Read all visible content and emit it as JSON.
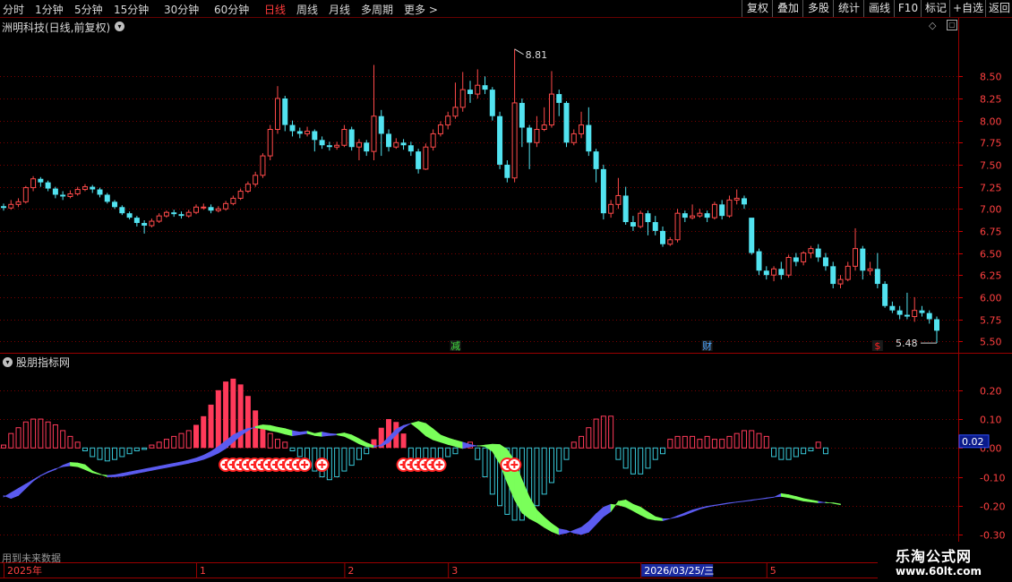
{
  "toolbar": {
    "periods": [
      "分时",
      "1分钟",
      "5分钟",
      "15分钟",
      "30分钟",
      "60分钟",
      "日线",
      "周线",
      "月线",
      "多周期",
      "更多 >"
    ],
    "active_period": "日线",
    "buttons": [
      "复权",
      "叠加",
      "多股",
      "统计",
      "画线",
      "F10",
      "标记",
      "+自选",
      "返回"
    ]
  },
  "main_title": "洲明科技(日线,前复权)",
  "indicator_title": "股朋指标网",
  "future_note": "用到未来数据",
  "watermark": {
    "name": "乐淘公式网",
    "url": "www.60lt.com"
  },
  "colors": {
    "up": "#ff4a4a",
    "down": "#52e3f0",
    "hist_pos": "#ff3a5a",
    "hist_neg": "#38c8d8",
    "wave_up": "#5b5bf0",
    "wave_down": "#7aff5a",
    "grid": "#7a0000",
    "signal": "#ff2020"
  },
  "chart_data": [
    {
      "type": "candlestick",
      "ylim": [
        5.38,
        8.98
      ],
      "yticks": [
        5.5,
        5.75,
        6.0,
        6.25,
        6.5,
        6.75,
        7.0,
        7.25,
        7.5,
        7.75,
        8.0,
        8.25,
        8.5
      ],
      "high_label": "8.81",
      "low_label": "5.48",
      "event_markers": [
        {
          "index": 61,
          "text": "减",
          "color": "#40e040"
        },
        {
          "index": 95,
          "text": "财",
          "color": "#4da6ff"
        },
        {
          "index": 118,
          "text": "$",
          "color": "#ff2020"
        }
      ],
      "candles": [
        [
          7.03,
          7.01,
          7.06,
          6.98
        ],
        [
          7.01,
          7.05,
          7.1,
          6.99
        ],
        [
          7.05,
          7.08,
          7.12,
          7.02
        ],
        [
          7.08,
          7.24,
          7.26,
          7.06
        ],
        [
          7.24,
          7.34,
          7.37,
          7.2
        ],
        [
          7.34,
          7.3,
          7.36,
          7.25
        ],
        [
          7.3,
          7.23,
          7.32,
          7.2
        ],
        [
          7.23,
          7.16,
          7.25,
          7.12
        ],
        [
          7.16,
          7.14,
          7.2,
          7.1
        ],
        [
          7.14,
          7.17,
          7.21,
          7.12
        ],
        [
          7.17,
          7.22,
          7.25,
          7.15
        ],
        [
          7.22,
          7.25,
          7.28,
          7.2
        ],
        [
          7.25,
          7.22,
          7.27,
          7.18
        ],
        [
          7.22,
          7.16,
          7.24,
          7.13
        ],
        [
          7.16,
          7.08,
          7.18,
          7.06
        ],
        [
          7.08,
          7.02,
          7.1,
          7.0
        ],
        [
          7.02,
          6.95,
          7.04,
          6.93
        ],
        [
          6.95,
          6.9,
          6.97,
          6.88
        ],
        [
          6.9,
          6.84,
          6.92,
          6.8
        ],
        [
          6.84,
          6.81,
          6.87,
          6.72
        ],
        [
          6.81,
          6.86,
          6.89,
          6.79
        ],
        [
          6.86,
          6.92,
          6.95,
          6.84
        ],
        [
          6.92,
          6.96,
          6.98,
          6.9
        ],
        [
          6.96,
          6.94,
          6.99,
          6.91
        ],
        [
          6.94,
          6.92,
          6.97,
          6.89
        ],
        [
          6.92,
          6.96,
          6.99,
          6.9
        ],
        [
          6.96,
          7.02,
          7.05,
          6.94
        ],
        [
          7.02,
          7.02,
          7.06,
          6.99
        ],
        [
          7.02,
          6.98,
          7.05,
          6.95
        ],
        [
          6.98,
          7.0,
          7.03,
          6.96
        ],
        [
          7.0,
          7.06,
          7.09,
          6.98
        ],
        [
          7.06,
          7.12,
          7.15,
          7.04
        ],
        [
          7.12,
          7.2,
          7.23,
          7.1
        ],
        [
          7.2,
          7.28,
          7.31,
          7.18
        ],
        [
          7.28,
          7.38,
          7.42,
          7.25
        ],
        [
          7.38,
          7.6,
          7.63,
          7.35
        ],
        [
          7.6,
          7.9,
          7.95,
          7.55
        ],
        [
          7.9,
          8.25,
          8.39,
          7.85
        ],
        [
          8.25,
          7.95,
          8.28,
          7.88
        ],
        [
          7.95,
          7.88,
          8.0,
          7.82
        ],
        [
          7.88,
          7.85,
          7.92,
          7.8
        ],
        [
          7.85,
          7.88,
          7.93,
          7.82
        ],
        [
          7.88,
          7.78,
          7.9,
          7.65
        ],
        [
          7.78,
          7.72,
          7.82,
          7.68
        ],
        [
          7.72,
          7.7,
          7.76,
          7.66
        ],
        [
          7.7,
          7.72,
          7.76,
          7.67
        ],
        [
          7.72,
          7.9,
          7.95,
          7.7
        ],
        [
          7.9,
          7.7,
          7.93,
          7.66
        ],
        [
          7.7,
          7.75,
          7.79,
          7.55
        ],
        [
          7.75,
          7.65,
          7.78,
          7.6
        ],
        [
          7.65,
          8.05,
          8.63,
          7.55
        ],
        [
          8.05,
          7.85,
          8.12,
          7.6
        ],
        [
          7.85,
          7.7,
          7.9,
          7.65
        ],
        [
          7.7,
          7.75,
          7.8,
          7.68
        ],
        [
          7.75,
          7.72,
          7.79,
          7.67
        ],
        [
          7.72,
          7.65,
          7.76,
          7.6
        ],
        [
          7.65,
          7.45,
          7.68,
          7.4
        ],
        [
          7.45,
          7.7,
          7.74,
          7.44
        ],
        [
          7.7,
          7.85,
          7.9,
          7.66
        ],
        [
          7.85,
          7.95,
          7.99,
          7.82
        ],
        [
          7.95,
          8.05,
          8.1,
          7.9
        ],
        [
          8.05,
          8.15,
          8.43,
          8.02
        ],
        [
          8.15,
          8.35,
          8.55,
          8.1
        ],
        [
          8.35,
          8.3,
          8.45,
          8.2
        ],
        [
          8.3,
          8.4,
          8.58,
          8.25
        ],
        [
          8.4,
          8.35,
          8.5,
          8.3
        ],
        [
          8.35,
          8.05,
          8.38,
          8.0
        ],
        [
          8.05,
          7.5,
          8.1,
          7.45
        ],
        [
          7.5,
          7.35,
          7.55,
          7.3
        ],
        [
          7.35,
          8.2,
          8.81,
          7.3
        ],
        [
          8.2,
          7.92,
          8.25,
          7.7
        ],
        [
          7.92,
          7.75,
          7.95,
          7.45
        ],
        [
          7.75,
          7.9,
          8.05,
          7.7
        ],
        [
          7.9,
          7.95,
          8.15,
          7.88
        ],
        [
          7.95,
          8.3,
          8.56,
          7.92
        ],
        [
          8.3,
          8.2,
          8.35,
          8.05
        ],
        [
          8.2,
          7.75,
          8.22,
          7.7
        ],
        [
          7.75,
          7.85,
          7.9,
          7.72
        ],
        [
          7.85,
          7.95,
          8.1,
          7.8
        ],
        [
          7.95,
          7.65,
          8.15,
          7.6
        ],
        [
          7.65,
          7.45,
          7.68,
          7.3
        ],
        [
          7.45,
          6.95,
          7.5,
          6.88
        ],
        [
          6.95,
          7.05,
          7.1,
          6.9
        ],
        [
          7.05,
          7.15,
          7.35,
          7.0
        ],
        [
          7.15,
          6.85,
          7.25,
          6.82
        ],
        [
          6.85,
          6.8,
          6.92,
          6.75
        ],
        [
          6.8,
          6.95,
          6.98,
          6.78
        ],
        [
          6.95,
          6.85,
          6.98,
          6.7
        ],
        [
          6.85,
          6.75,
          6.92,
          6.7
        ],
        [
          6.75,
          6.6,
          6.8,
          6.57
        ],
        [
          6.6,
          6.65,
          6.68,
          6.58
        ],
        [
          6.65,
          6.95,
          7.0,
          6.62
        ],
        [
          6.95,
          6.9,
          6.98,
          6.85
        ],
        [
          6.9,
          6.92,
          7.05,
          6.88
        ],
        [
          6.92,
          6.95,
          7.0,
          6.9
        ],
        [
          6.95,
          6.9,
          6.98,
          6.85
        ],
        [
          6.9,
          7.05,
          7.08,
          6.88
        ],
        [
          7.05,
          6.92,
          7.1,
          6.88
        ],
        [
          6.92,
          7.1,
          7.15,
          6.9
        ],
        [
          7.1,
          7.12,
          7.22,
          7.05
        ],
        [
          7.12,
          7.05,
          7.15,
          7.0
        ],
        [
          6.9,
          6.5,
          6.52,
          6.48
        ],
        [
          6.52,
          6.3,
          6.55,
          6.25
        ],
        [
          6.3,
          6.25,
          6.35,
          6.2
        ],
        [
          6.25,
          6.32,
          6.35,
          6.18
        ],
        [
          6.32,
          6.25,
          6.4,
          6.2
        ],
        [
          6.25,
          6.45,
          6.48,
          6.22
        ],
        [
          6.45,
          6.4,
          6.5,
          6.35
        ],
        [
          6.4,
          6.5,
          6.52,
          6.36
        ],
        [
          6.5,
          6.55,
          6.58,
          6.44
        ],
        [
          6.55,
          6.45,
          6.6,
          6.4
        ],
        [
          6.45,
          6.35,
          6.5,
          6.3
        ],
        [
          6.35,
          6.15,
          6.4,
          6.1
        ],
        [
          6.15,
          6.2,
          6.25,
          6.1
        ],
        [
          6.2,
          6.35,
          6.4,
          6.18
        ],
        [
          6.35,
          6.55,
          6.78,
          6.3
        ],
        [
          6.55,
          6.3,
          6.58,
          6.2
        ],
        [
          6.3,
          6.32,
          6.4,
          6.25
        ],
        [
          6.32,
          6.15,
          6.5,
          6.1
        ],
        [
          6.15,
          5.9,
          6.18,
          5.88
        ],
        [
          5.9,
          5.85,
          5.95,
          5.82
        ],
        [
          5.85,
          5.8,
          5.9,
          5.75
        ],
        [
          5.8,
          5.78,
          6.05,
          5.75
        ],
        [
          5.78,
          5.85,
          6.0,
          5.72
        ],
        [
          5.85,
          5.82,
          5.9,
          5.78
        ],
        [
          5.82,
          5.75,
          5.85,
          5.7
        ],
        [
          5.75,
          5.62,
          5.78,
          5.48
        ]
      ]
    },
    {
      "type": "indicator",
      "ylim": [
        -0.3,
        0.28
      ],
      "yticks": [
        0.2,
        0.1,
        0.0,
        -0.1,
        -0.2,
        -0.3
      ],
      "current_value": "0.02",
      "hist": [
        0.01,
        0.05,
        0.07,
        0.09,
        0.1,
        0.1,
        0.09,
        0.08,
        0.06,
        0.04,
        0.02,
        -0.01,
        -0.03,
        -0.04,
        -0.045,
        -0.04,
        -0.03,
        -0.02,
        -0.01,
        -0.005,
        0.01,
        0.02,
        0.03,
        0.04,
        0.05,
        0.06,
        0.08,
        0.11,
        0.15,
        0.2,
        0.23,
        0.24,
        0.22,
        0.18,
        0.13,
        0.08,
        0.05,
        0.03,
        0.02,
        -0.01,
        -0.03,
        -0.05,
        -0.08,
        -0.1,
        -0.11,
        -0.1,
        -0.08,
        -0.06,
        -0.04,
        -0.02,
        0.03,
        0.07,
        0.1,
        0.09,
        0.05,
        -0.05,
        -0.07,
        -0.08,
        -0.07,
        -0.05,
        -0.03,
        -0.02,
        0.01,
        0.02,
        -0.04,
        -0.1,
        -0.16,
        -0.2,
        -0.23,
        -0.25,
        -0.25,
        -0.23,
        -0.2,
        -0.16,
        -0.12,
        -0.08,
        -0.04,
        0.02,
        0.04,
        0.07,
        0.1,
        0.11,
        0.11,
        -0.04,
        -0.07,
        -0.09,
        -0.09,
        -0.07,
        -0.04,
        -0.02,
        0.03,
        0.04,
        0.04,
        0.04,
        0.03,
        0.04,
        0.03,
        0.03,
        0.04,
        0.05,
        0.06,
        0.06,
        0.05,
        0.04,
        -0.03,
        -0.04,
        -0.04,
        -0.03,
        -0.02,
        -0.01,
        0.02,
        -0.02
      ],
      "wave": [
        -0.17,
        -0.155,
        -0.14,
        -0.125,
        -0.11,
        -0.095,
        -0.082,
        -0.072,
        -0.065,
        -0.062,
        -0.065,
        -0.075,
        -0.086,
        -0.092,
        -0.095,
        -0.093,
        -0.088,
        -0.083,
        -0.078,
        -0.073,
        -0.068,
        -0.063,
        -0.058,
        -0.053,
        -0.048,
        -0.042,
        -0.035,
        -0.025,
        -0.012,
        0.005,
        0.025,
        0.045,
        0.058,
        0.068,
        0.07,
        0.066,
        0.06,
        0.055,
        0.048,
        0.042,
        0.046,
        0.05,
        0.043,
        0.04,
        0.043,
        0.045,
        0.04,
        0.028,
        0.014,
        0.004,
        0.002,
        0.012,
        0.038,
        0.065,
        0.078,
        0.085,
        0.065,
        0.042,
        0.028,
        0.02,
        0.012,
        0.005,
        -0.002,
        0.004,
        0.008,
        0.005,
        -0.012,
        -0.055,
        -0.12,
        -0.18,
        -0.225,
        -0.245,
        -0.258,
        -0.275,
        -0.29,
        -0.3,
        -0.295,
        -0.285,
        -0.275,
        -0.255,
        -0.228,
        -0.205,
        -0.195,
        -0.198,
        -0.205,
        -0.218,
        -0.232,
        -0.245,
        -0.25,
        -0.252,
        -0.245,
        -0.235,
        -0.225,
        -0.215,
        -0.208,
        -0.202,
        -0.198,
        -0.194,
        -0.19,
        -0.187,
        -0.184,
        -0.18,
        -0.177,
        -0.173,
        -0.17,
        -0.168,
        -0.172,
        -0.178,
        -0.184,
        -0.187,
        -0.19,
        -0.188,
        -0.192,
        -0.197
      ],
      "wave_prev": [
        -0.165,
        -0.175,
        -0.165,
        -0.14,
        -0.115,
        -0.097,
        -0.085,
        -0.075,
        -0.06,
        -0.05,
        -0.052,
        -0.058,
        -0.08,
        -0.09,
        -0.1,
        -0.1,
        -0.098,
        -0.093,
        -0.088,
        -0.083,
        -0.078,
        -0.073,
        -0.068,
        -0.063,
        -0.058,
        -0.053,
        -0.047,
        -0.04,
        -0.03,
        -0.018,
        -0.002,
        0.02,
        0.042,
        0.06,
        0.074,
        0.08,
        0.078,
        0.072,
        0.067,
        0.06,
        0.055,
        0.058,
        0.05,
        0.055,
        0.05,
        0.048,
        0.052,
        0.045,
        0.032,
        0.018,
        0.008,
        0.006,
        0.018,
        0.045,
        0.07,
        0.085,
        0.092,
        0.085,
        0.066,
        0.045,
        0.035,
        0.027,
        0.02,
        0.012,
        0.007,
        0.01,
        0.013,
        0.012,
        -0.005,
        -0.045,
        -0.11,
        -0.17,
        -0.215,
        -0.24,
        -0.262,
        -0.28,
        -0.285,
        -0.295,
        -0.3,
        -0.292,
        -0.265,
        -0.238,
        -0.22,
        -0.185,
        -0.18,
        -0.195,
        -0.205,
        -0.222,
        -0.238,
        -0.245,
        -0.245,
        -0.24,
        -0.232,
        -0.222,
        -0.212,
        -0.205,
        -0.2,
        -0.196,
        -0.192,
        -0.188,
        -0.185,
        -0.182,
        -0.178,
        -0.175,
        -0.171,
        -0.158,
        -0.162,
        -0.168,
        -0.175,
        -0.18,
        -0.185,
        -0.19,
        -0.19,
        -0.194
      ],
      "signals": [
        {
          "count": 12,
          "start_index": 30
        },
        {
          "count": 1,
          "start_index": 43
        },
        {
          "count": 6,
          "start_index": 54
        },
        {
          "count": 2,
          "start_index": 68
        }
      ]
    }
  ],
  "x_axis": [
    {
      "index": 0,
      "label": "2025年"
    },
    {
      "index": 26,
      "label": "1"
    },
    {
      "index": 46,
      "label": "2"
    },
    {
      "index": 60,
      "label": "3"
    },
    {
      "index": 86,
      "label": "2026/03/25/三",
      "highlight": true
    },
    {
      "index": 103,
      "label": "5"
    }
  ]
}
